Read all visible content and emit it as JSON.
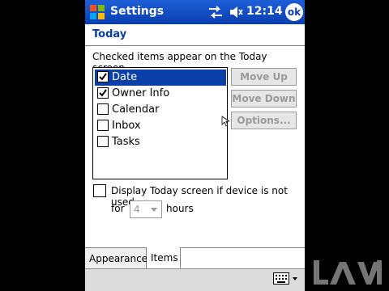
{
  "titlebar": {
    "title": "Settings",
    "time": "12:14",
    "ok_label": "ok"
  },
  "header": {
    "title": "Today"
  },
  "description": "Checked items appear on the Today screen.",
  "items": [
    {
      "label": "Date",
      "checked": true,
      "selected": true
    },
    {
      "label": "Owner Info",
      "checked": true,
      "selected": false
    },
    {
      "label": "Calendar",
      "checked": false,
      "selected": false
    },
    {
      "label": "Inbox",
      "checked": false,
      "selected": false
    },
    {
      "label": "Tasks",
      "checked": false,
      "selected": false
    }
  ],
  "buttons": {
    "move_up": "Move Up",
    "move_down": "Move Down",
    "options": "Options..."
  },
  "display_option": {
    "line1": "Display Today screen if device is not used",
    "for_label": "for",
    "hours_value": "4",
    "hours_label": "hours",
    "checked": false
  },
  "tabs": [
    {
      "label": "Appearance",
      "active": false
    },
    {
      "label": "Items",
      "active": true
    }
  ],
  "colors": {
    "titlebar": "#0a3fb0",
    "selection": "#0b3fa8",
    "header_text": "#0b3f9e",
    "disabled_text": "#9a9a9a"
  }
}
